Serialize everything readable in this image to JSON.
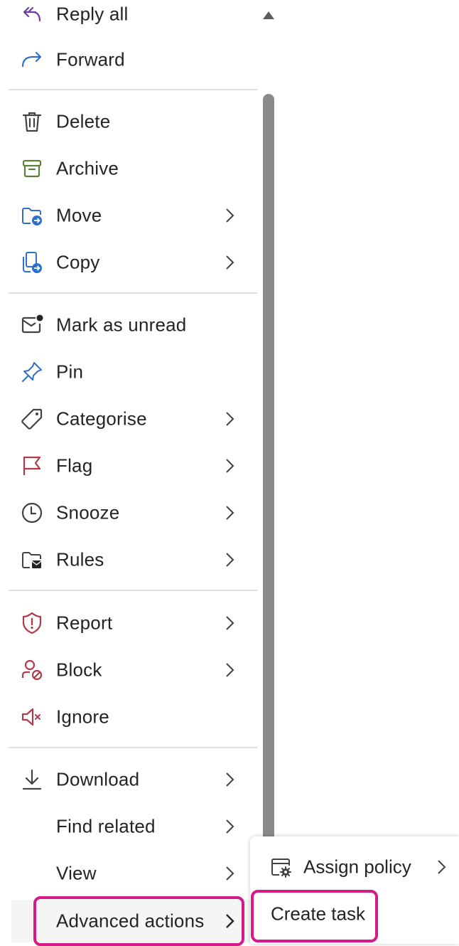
{
  "menu": {
    "items": [
      {
        "label": "Reply all",
        "icon": "reply-all-icon",
        "submenu": false
      },
      {
        "label": "Forward",
        "icon": "forward-icon",
        "submenu": false
      },
      {
        "label": "Delete",
        "icon": "delete-icon",
        "submenu": false
      },
      {
        "label": "Archive",
        "icon": "archive-icon",
        "submenu": false
      },
      {
        "label": "Move",
        "icon": "move-folder-icon",
        "submenu": true
      },
      {
        "label": "Copy",
        "icon": "copy-icon",
        "submenu": true
      },
      {
        "label": "Mark as unread",
        "icon": "mail-unread-icon",
        "submenu": false
      },
      {
        "label": "Pin",
        "icon": "pin-icon",
        "submenu": false
      },
      {
        "label": "Categorise",
        "icon": "tag-icon",
        "submenu": true
      },
      {
        "label": "Flag",
        "icon": "flag-icon",
        "submenu": true
      },
      {
        "label": "Snooze",
        "icon": "clock-icon",
        "submenu": true
      },
      {
        "label": "Rules",
        "icon": "rules-folder-icon",
        "submenu": true
      },
      {
        "label": "Report",
        "icon": "shield-alert-icon",
        "submenu": true
      },
      {
        "label": "Block",
        "icon": "person-block-icon",
        "submenu": true
      },
      {
        "label": "Ignore",
        "icon": "speaker-mute-icon",
        "submenu": false
      },
      {
        "label": "Download",
        "icon": "download-icon",
        "submenu": true
      },
      {
        "label": "Find related",
        "icon": "",
        "submenu": true
      },
      {
        "label": "View",
        "icon": "",
        "submenu": true
      },
      {
        "label": "Advanced actions",
        "icon": "",
        "submenu": true
      }
    ]
  },
  "submenu": {
    "items": [
      {
        "label": "Assign policy",
        "icon": "policy-settings-icon",
        "submenu": true
      },
      {
        "label": "Create task",
        "icon": "",
        "submenu": false
      }
    ]
  },
  "colors": {
    "highlight": "#d61a8a",
    "text": "#242424",
    "separator": "#e0e0e0",
    "archive_green": "#5b7f3b",
    "blue": "#2f6fd0",
    "red": "#b03a48"
  }
}
